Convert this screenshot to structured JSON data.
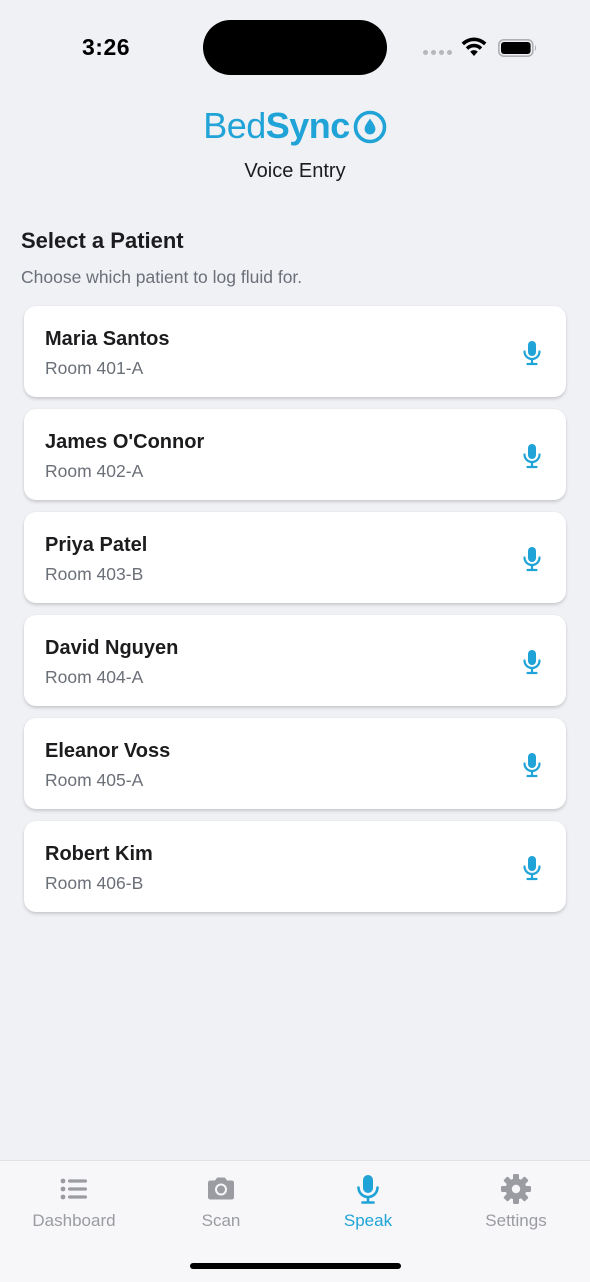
{
  "status": {
    "time": "3:26"
  },
  "brand": {
    "part1": "Bed",
    "part2": "Sync",
    "icon": "water-drop-icon"
  },
  "header": {
    "subtitle": "Voice Entry"
  },
  "section": {
    "title": "Select a Patient",
    "subtitle": "Choose which patient to log fluid for."
  },
  "patients": [
    {
      "name": "Maria Santos",
      "room": "Room 401-A"
    },
    {
      "name": "James O'Connor",
      "room": "Room 402-A"
    },
    {
      "name": "Priya Patel",
      "room": "Room 403-B"
    },
    {
      "name": "David Nguyen",
      "room": "Room 404-A"
    },
    {
      "name": "Eleanor Voss",
      "room": "Room 405-A"
    },
    {
      "name": "Robert Kim",
      "room": "Room 406-B"
    }
  ],
  "tabs": [
    {
      "label": "Dashboard",
      "icon": "list-icon",
      "active": false
    },
    {
      "label": "Scan",
      "icon": "camera-icon",
      "active": false
    },
    {
      "label": "Speak",
      "icon": "microphone-icon",
      "active": true
    },
    {
      "label": "Settings",
      "icon": "gear-icon",
      "active": false
    }
  ],
  "colors": {
    "accent": "#20a3d6",
    "inactive": "#9a9ca2",
    "background": "#f0f1f5"
  }
}
